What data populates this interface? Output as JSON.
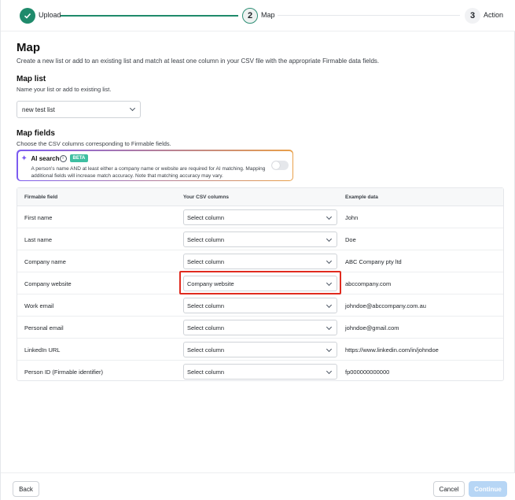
{
  "stepper": {
    "steps": [
      {
        "number": "",
        "label": "Upload",
        "state": "done"
      },
      {
        "number": "2",
        "label": "Map",
        "state": "active"
      },
      {
        "number": "3",
        "label": "Action",
        "state": "todo"
      }
    ]
  },
  "page": {
    "title": "Map",
    "description": "Create a new list or add to an existing list and match at least one column in your CSV file with the appropriate Firmable data fields."
  },
  "map_list": {
    "title": "Map list",
    "description": "Name your list or add to existing list.",
    "selected": "new test list"
  },
  "map_fields": {
    "title": "Map fields",
    "description": "Choose the CSV columns corresponding to Firmable fields."
  },
  "ai_search": {
    "title": "AI search",
    "badge": "BETA",
    "description": "A person's name AND at least either a company name or website are required for AI matching. Mapping additional fields will increase match accuracy. Note that matching accuracy may vary.",
    "enabled": false
  },
  "table": {
    "headers": [
      "Firmable field",
      "Your CSV columns",
      "Example data"
    ],
    "rows": [
      {
        "field": "First name",
        "column": "Select column",
        "example": "John"
      },
      {
        "field": "Last name",
        "column": "Select column",
        "example": "Doe"
      },
      {
        "field": "Company name",
        "column": "Select column",
        "example": "ABC Company pty ltd"
      },
      {
        "field": "Company website",
        "column": "Company website",
        "example": "abccompany.com"
      },
      {
        "field": "Work email",
        "column": "Select column",
        "example": "johndoe@abccompany.com.au"
      },
      {
        "field": "Personal email",
        "column": "Select column",
        "example": "johndoe@gmail.com"
      },
      {
        "field": "LinkedIn URL",
        "column": "Select column",
        "example": "https://www.linkedin.com/in/johndoe"
      },
      {
        "field": "Person ID (Firmable identifier)",
        "column": "Select column",
        "example": "fp000000000000"
      }
    ]
  },
  "footer": {
    "back": "Back",
    "cancel": "Cancel",
    "continue": "Continue"
  },
  "colors": {
    "accent": "#1f8a6b",
    "highlight": "#e02b1f",
    "continue_disabled": "#b7d6f5"
  }
}
